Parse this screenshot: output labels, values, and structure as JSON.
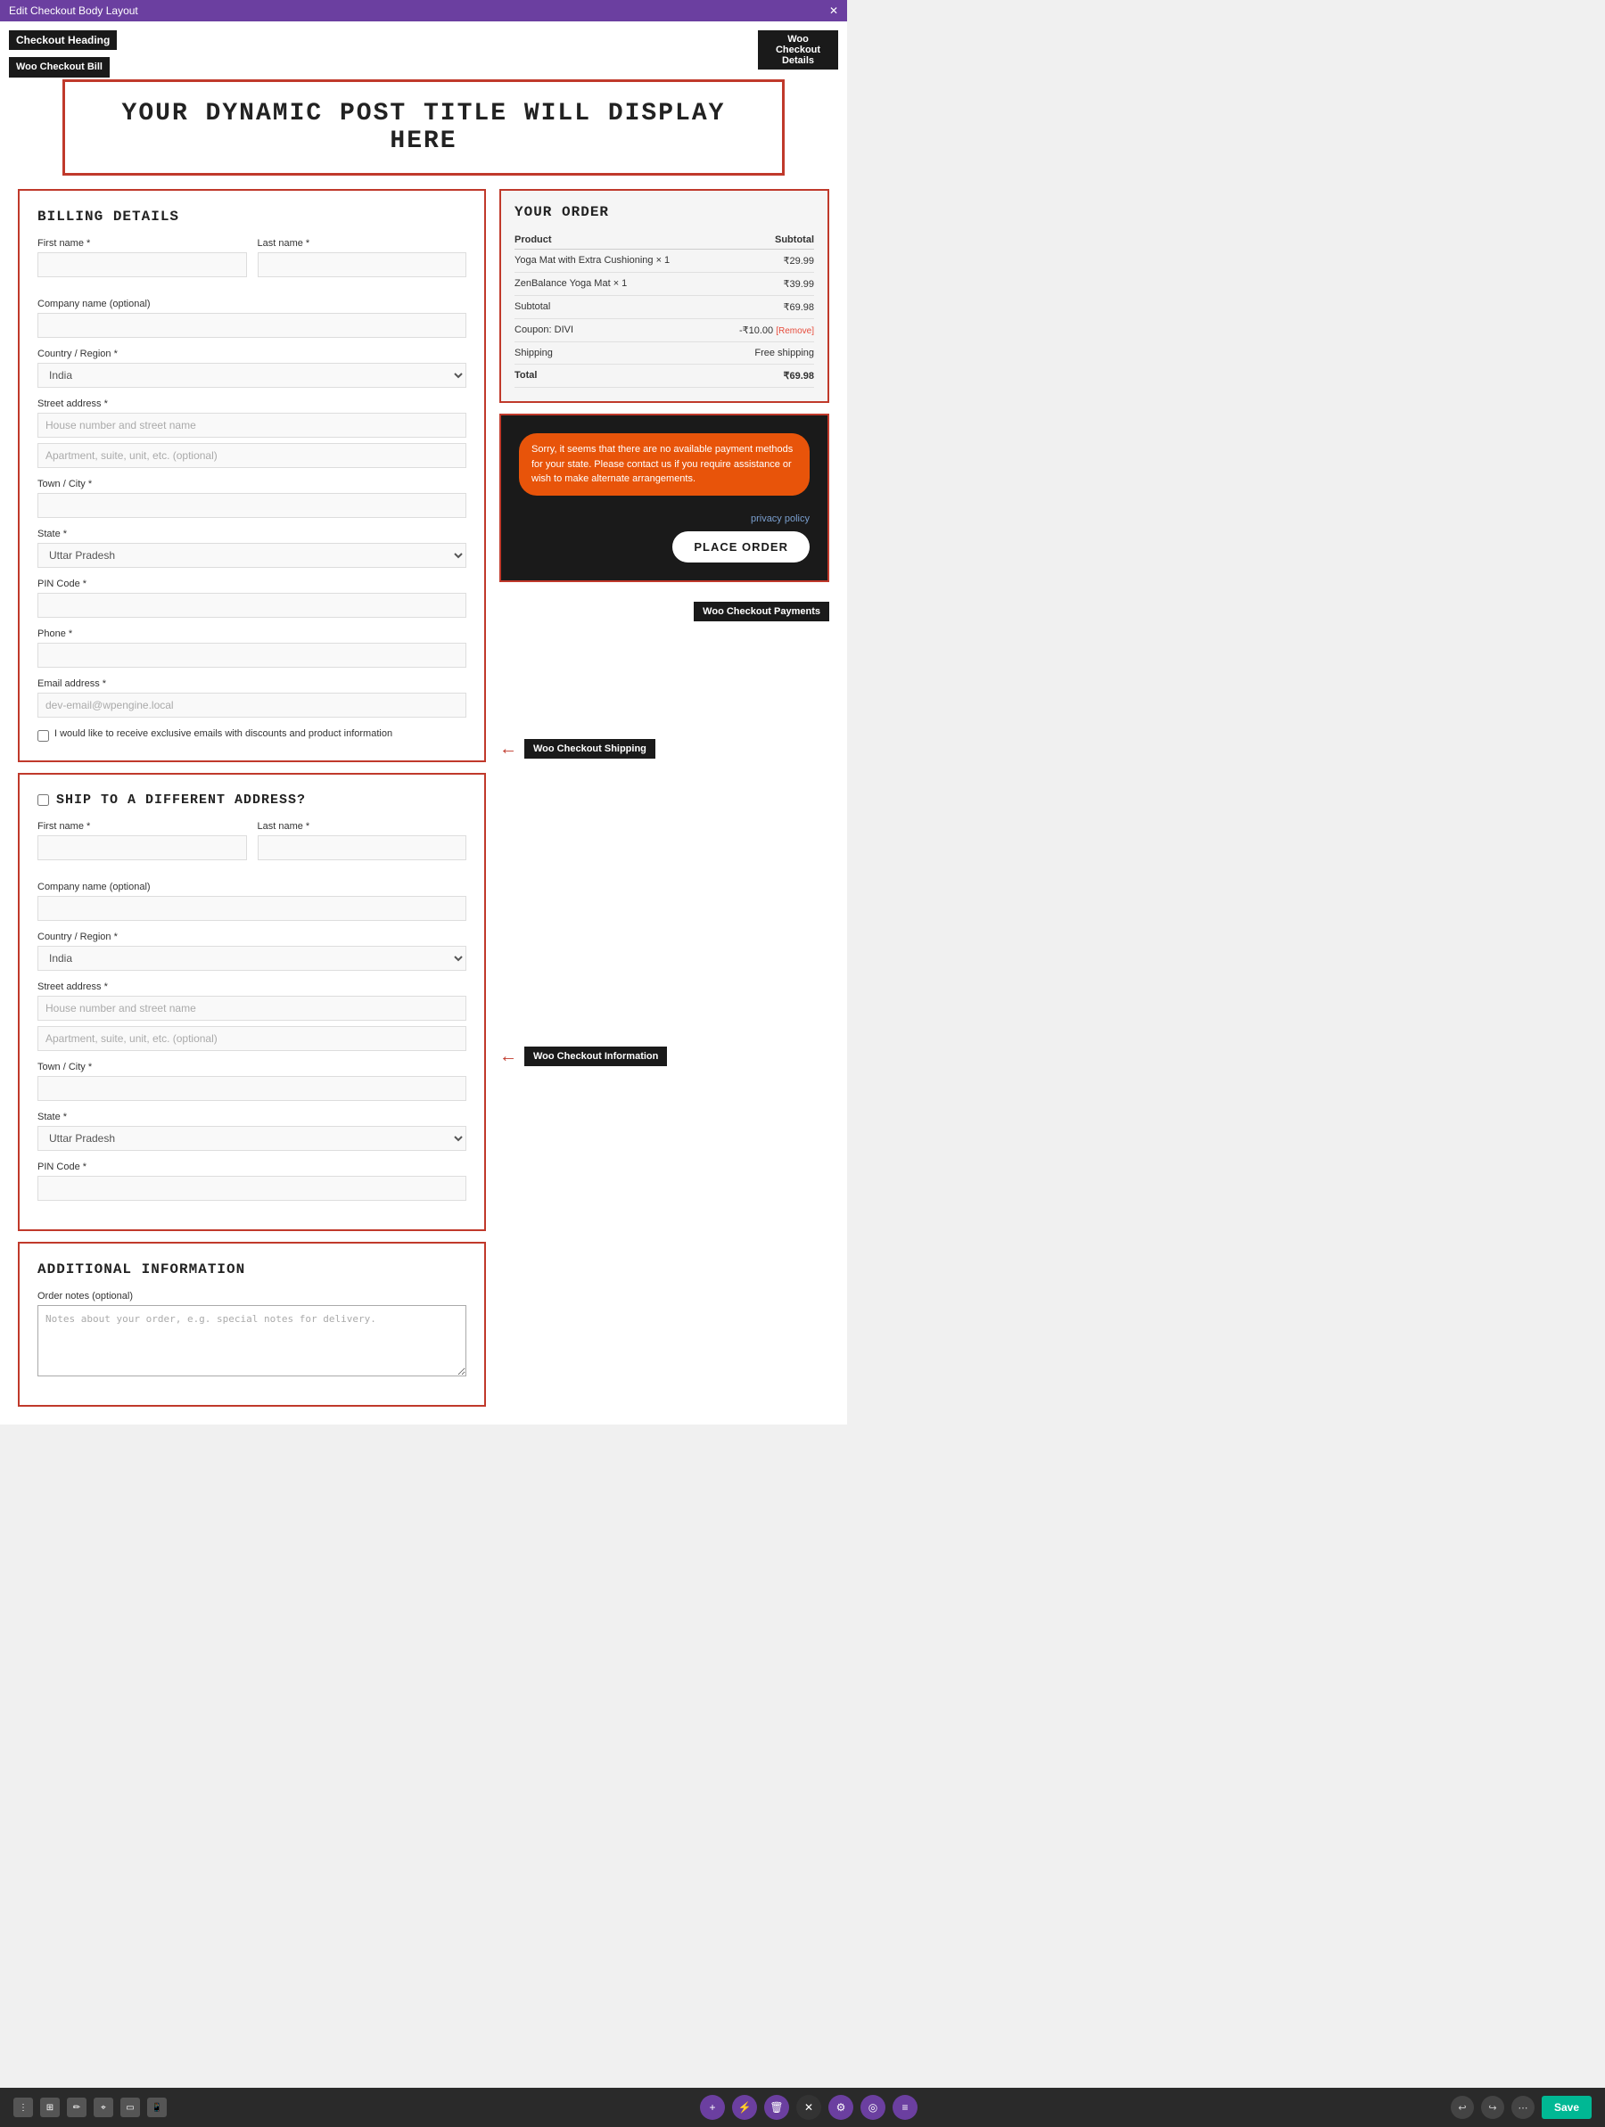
{
  "topbar": {
    "title": "Edit Checkout Body Layout",
    "close": "✕"
  },
  "labels": {
    "checkout_heading": "Checkout Heading",
    "woo_checkout_bill": "Woo Checkout Bill",
    "woo_checkout_details": "Woo Checkout Details",
    "woo_checkout_payments": "Woo Checkout Payments",
    "woo_checkout_shipping": "Woo Checkout Shipping",
    "woo_checkout_information": "Woo Checkout Information"
  },
  "dynamic_title": "YOUR DYNAMIC POST TITLE WILL DISPLAY HERE",
  "billing": {
    "section_title": "Billing Details",
    "first_name_label": "First name *",
    "last_name_label": "Last name *",
    "company_label": "Company name (optional)",
    "country_label": "Country / Region *",
    "country_value": "India",
    "street_label": "Street address *",
    "street_placeholder": "House number and street name",
    "apt_placeholder": "Apartment, suite, unit, etc. (optional)",
    "town_label": "Town / City *",
    "state_label": "State *",
    "state_value": "Uttar Pradesh",
    "pin_label": "PIN Code *",
    "phone_label": "Phone *",
    "email_label": "Email address *",
    "email_placeholder": "dev-email@wpengine.local",
    "newsletter_label": "I would like to receive exclusive emails with discounts and product information"
  },
  "shipping": {
    "section_title": "Ship to a different address?",
    "first_name_label": "First name *",
    "last_name_label": "Last name *",
    "company_label": "Company name (optional)",
    "country_label": "Country / Region *",
    "country_value": "India",
    "street_label": "Street address *",
    "street_placeholder": "House number and street name",
    "apt_placeholder": "Apartment, suite, unit, etc. (optional)",
    "town_label": "Town / City *",
    "state_label": "State *",
    "state_value": "Uttar Pradesh",
    "pin_label": "PIN Code *"
  },
  "additional": {
    "section_title": "Additional Information",
    "order_notes_label": "Order notes (optional)",
    "order_notes_placeholder": "Notes about your order, e.g. special notes for delivery."
  },
  "order": {
    "title": "Your Order",
    "product_header": "Product",
    "subtotal_header": "Subtotal",
    "items": [
      {
        "name": "Yoga Mat with Extra Cushioning × 1",
        "price": "₹29.99"
      },
      {
        "name": "ZenBalance Yoga Mat × 1",
        "price": "₹39.99"
      }
    ],
    "subtotal_label": "Subtotal",
    "subtotal_value": "₹69.98",
    "coupon_label": "Coupon: DIVI",
    "coupon_value": "-₹10.00",
    "coupon_remove": "[Remove]",
    "shipping_label": "Shipping",
    "shipping_value": "Free shipping",
    "total_label": "Total",
    "total_value": "₹69.98"
  },
  "payment": {
    "error_message": "Sorry, it seems that there are no available payment methods for your state. Please contact us if you require assistance or wish to make alternate arrangements.",
    "privacy_link": "privacy policy",
    "place_order_btn": "PLACE ORDER"
  },
  "toolbar": {
    "save_btn": "Save",
    "undo_icon": "↩",
    "dots_icon": "⋮"
  }
}
